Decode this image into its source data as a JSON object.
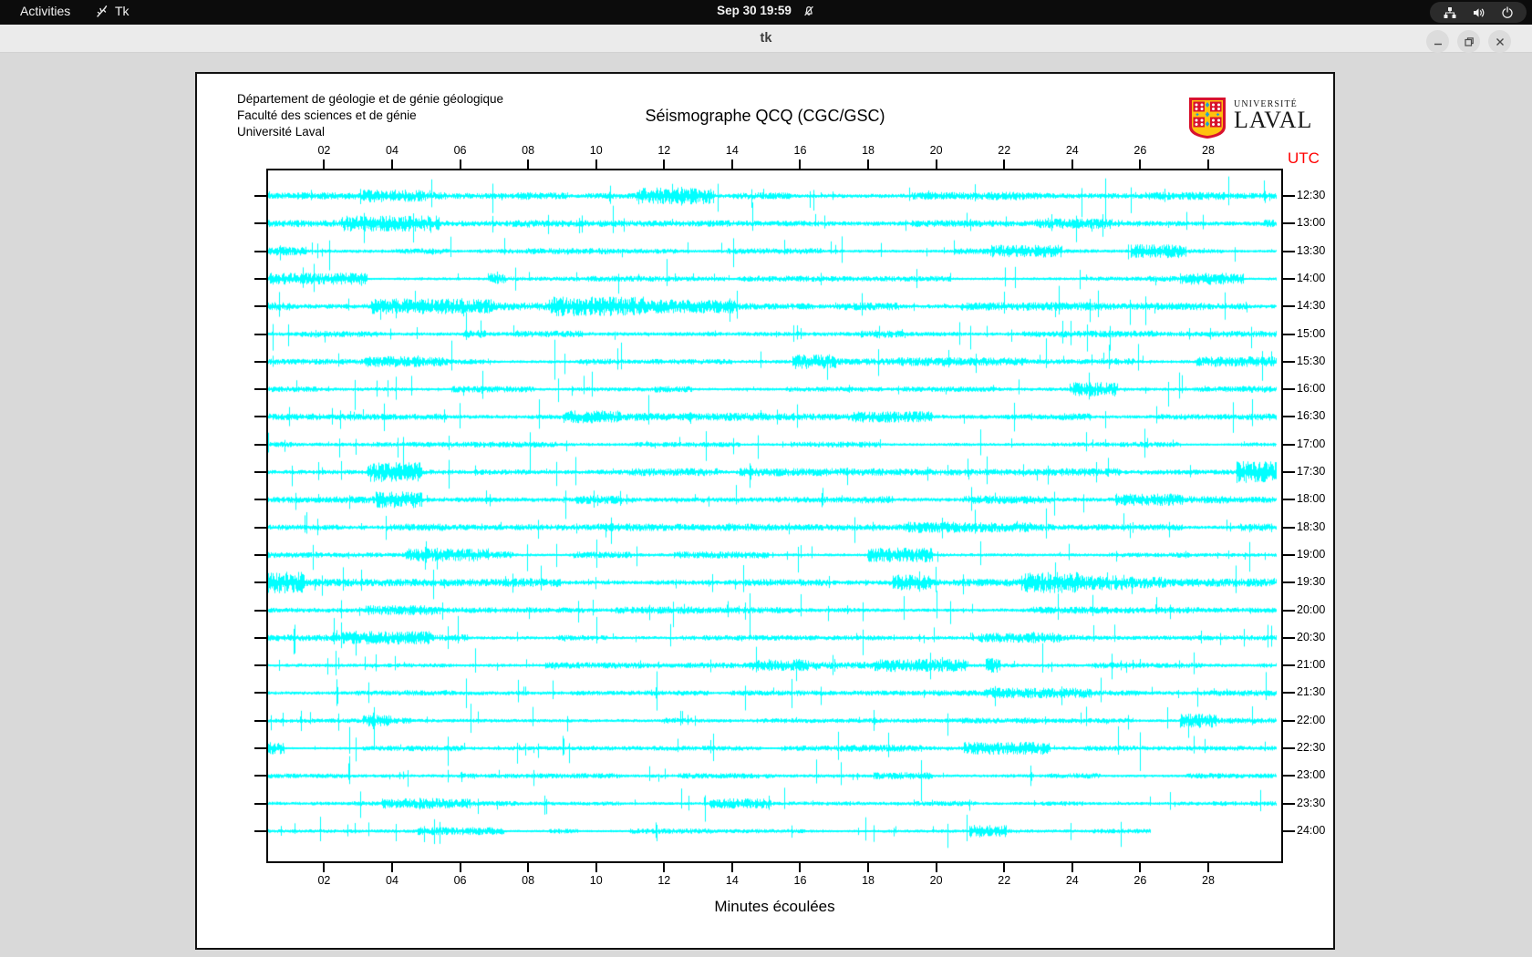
{
  "top_bar": {
    "activities": "Activities",
    "app_name": "Tk",
    "clock": "Sep 30 19:59",
    "icons": [
      "tk-feather-icon",
      "notifications-muted-icon",
      "network-wired-icon",
      "volume-icon",
      "power-icon"
    ]
  },
  "title_bar": {
    "title": "tk",
    "buttons": [
      "minimize",
      "maximize",
      "close"
    ]
  },
  "panel": {
    "header_lines": [
      "Département de géologie et de génie géologique",
      "Faculté des sciences et de génie",
      "Université Laval"
    ],
    "title": "Séismographe QCQ (CGC/GSC)",
    "logo_line1": "UNIVERSITÉ",
    "logo_line2": "LAVAL",
    "utc": "UTC",
    "xlabel": "Minutes écoulées",
    "colors": {
      "trace": "#00ffff",
      "utc_label": "#ff0000",
      "axis": "#000000"
    }
  },
  "chart_data": {
    "type": "line",
    "description": "Helicorder seismograph drum plot, 24 half-hour cyan traces",
    "x_min": 0.3,
    "x_max": 30.2,
    "x_tick_minutes": [
      2,
      4,
      6,
      8,
      10,
      12,
      14,
      16,
      18,
      20,
      22,
      24,
      26,
      28
    ],
    "x_tick_labels": [
      "02",
      "04",
      "06",
      "08",
      "10",
      "12",
      "14",
      "16",
      "18",
      "20",
      "22",
      "24",
      "26",
      "28"
    ],
    "xlabel": "Minutes écoulées",
    "right_axis_title": "UTC",
    "traces": [
      {
        "utc": "12:30",
        "amp": 2.4,
        "spikes": 55,
        "seed": 101,
        "len": 1
      },
      {
        "utc": "13:00",
        "amp": 2.2,
        "spikes": 40,
        "seed": 102,
        "len": 1
      },
      {
        "utc": "13:30",
        "amp": 1.8,
        "spikes": 35,
        "seed": 103,
        "len": 1
      },
      {
        "utc": "14:00",
        "amp": 1.6,
        "spikes": 30,
        "seed": 104,
        "len": 1
      },
      {
        "utc": "14:30",
        "amp": 2.3,
        "spikes": 45,
        "seed": 105,
        "len": 1
      },
      {
        "utc": "15:00",
        "amp": 2.2,
        "spikes": 50,
        "seed": 106,
        "len": 1
      },
      {
        "utc": "15:30",
        "amp": 1.9,
        "spikes": 45,
        "seed": 107,
        "len": 1
      },
      {
        "utc": "16:00",
        "amp": 1.8,
        "spikes": 40,
        "seed": 108,
        "len": 1
      },
      {
        "utc": "16:30",
        "amp": 2.4,
        "spikes": 50,
        "seed": 109,
        "len": 1
      },
      {
        "utc": "17:00",
        "amp": 1.6,
        "spikes": 35,
        "seed": 110,
        "len": 1
      },
      {
        "utc": "17:30",
        "amp": 2.6,
        "spikes": 45,
        "seed": 111,
        "len": 1
      },
      {
        "utc": "18:00",
        "amp": 2.3,
        "spikes": 40,
        "seed": 112,
        "len": 1
      },
      {
        "utc": "18:30",
        "amp": 2.2,
        "spikes": 45,
        "seed": 113,
        "len": 1
      },
      {
        "utc": "19:00",
        "amp": 1.9,
        "spikes": 35,
        "seed": 114,
        "len": 1
      },
      {
        "utc": "19:30",
        "amp": 2.6,
        "spikes": 55,
        "seed": 115,
        "len": 1
      },
      {
        "utc": "20:00",
        "amp": 2.2,
        "spikes": 45,
        "seed": 116,
        "len": 1
      },
      {
        "utc": "20:30",
        "amp": 1.9,
        "spikes": 40,
        "seed": 117,
        "len": 1
      },
      {
        "utc": "21:00",
        "amp": 1.9,
        "spikes": 45,
        "seed": 118,
        "len": 1
      },
      {
        "utc": "21:30",
        "amp": 1.6,
        "spikes": 35,
        "seed": 119,
        "len": 1
      },
      {
        "utc": "22:00",
        "amp": 1.8,
        "spikes": 45,
        "seed": 120,
        "len": 1
      },
      {
        "utc": "22:30",
        "amp": 1.6,
        "spikes": 40,
        "seed": 121,
        "len": 1
      },
      {
        "utc": "23:00",
        "amp": 1.5,
        "spikes": 30,
        "seed": 122,
        "len": 1
      },
      {
        "utc": "23:30",
        "amp": 1.4,
        "spikes": 30,
        "seed": 123,
        "len": 1
      },
      {
        "utc": "24:00",
        "amp": 1.6,
        "spikes": 30,
        "seed": 124,
        "len": 0.875
      }
    ]
  }
}
